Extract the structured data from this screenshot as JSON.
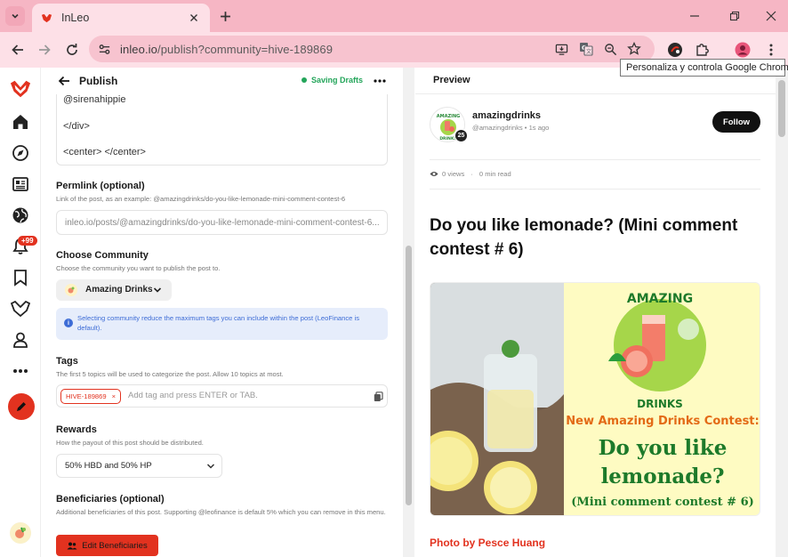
{
  "browser": {
    "tab_title": "InLeo",
    "url_host": "inleo.io",
    "url_path": "/publish?community=hive-189869",
    "tooltip": "Personaliza y controla Google Chrome"
  },
  "colors": {
    "brand": "#e2321f",
    "chrome_tab_strip": "#f6b6c4",
    "chrome_toolbar": "#fde0e7",
    "success": "#23a55a",
    "info": "#3d6cd6"
  },
  "sidebar": {
    "items": [
      "leo-logo-icon",
      "home-icon",
      "explore-icon",
      "news-icon",
      "globe-icon",
      "bell-icon",
      "bookmark-icon",
      "leo-icon",
      "profile-icon",
      "more-icon"
    ],
    "notif_count": "+99"
  },
  "editor": {
    "title": "Publish",
    "saving_status": "Saving Drafts",
    "code_lines": [
      "@sirenahippie",
      "</div>",
      "<center> </center>"
    ],
    "permlink": {
      "title": "Permlink (optional)",
      "desc": "Link of the post, as an example: @amazingdrinks/do-you-like-lemonade-mini-comment-contest-6",
      "value": "inleo.io/posts/@amazingdrinks/do-you-like-lemonade-mini-comment-contest-6..."
    },
    "community": {
      "title": "Choose Community",
      "desc": "Choose the community you want to publish the post to.",
      "selected": "Amazing Drinks",
      "info": "Selecting community reduce the maximum tags you can include within the post (LeoFinance is default)."
    },
    "tags": {
      "title": "Tags",
      "desc": "The first 5 topics will be used to categorize the post. Allow 10 topics at most.",
      "chip": "HIVE-189869",
      "chip_remove": "×",
      "placeholder": "Add tag and press ENTER or TAB."
    },
    "rewards": {
      "title": "Rewards",
      "desc": "How the payout of this post should be distributed.",
      "selected": "50% HBD and 50% HP"
    },
    "beneficiaries": {
      "title": "Beneficiaries (optional)",
      "desc": "Additional beneficiaries of this post. Supporting @leofinance is default 5% which you can remove in this menu.",
      "button": "Edit Beneficiaries"
    }
  },
  "preview": {
    "title": "Preview",
    "author": "amazingdrinks",
    "handle": "@amazingdrinks",
    "time": "1s ago",
    "level": "25",
    "follow": "Follow",
    "views": "0 views",
    "read_time": "0 min read",
    "post_title": "Do you like lemonade? (Mini comment contest # 6)",
    "image": {
      "brand_line1": "AMAZING",
      "brand_line2": "DRINKS",
      "headline": "New Amazing Drinks Contest:",
      "question_line1": "Do you like",
      "question_line2": "lemonade?",
      "subtitle": "(Mini comment contest # 6)"
    },
    "photo_credit": "Photo by Pesce Huang"
  }
}
